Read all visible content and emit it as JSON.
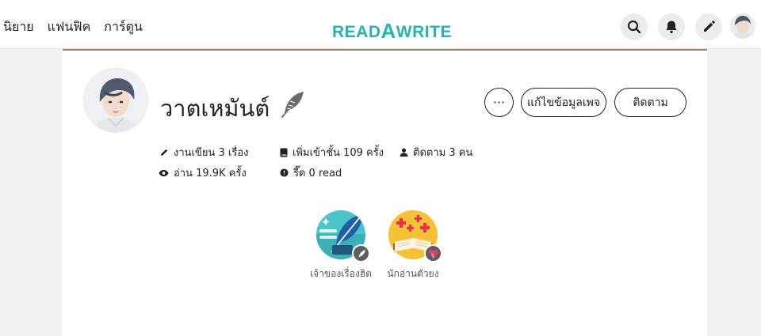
{
  "header": {
    "nav": [
      "นิยาย",
      "แฟนฟิค",
      "การ์ตูน"
    ],
    "logo_parts": [
      "READ",
      "A",
      "WRITE"
    ],
    "icons": [
      "search-icon",
      "bell-icon",
      "pencil-icon"
    ]
  },
  "profile": {
    "name": "วาตเหมันต์",
    "buttons": {
      "more": "···",
      "edit": "แก้ไขข้อมูลเพจ",
      "follow": "ติดตาม"
    },
    "stats": {
      "works": "งานเขียน 3 เรื่อง",
      "shelf": "เพิ่มเข้าชั้น 109 ครั้ง",
      "followers": "ติดตาม 3 คน",
      "reads": "อ่าน 19.9K ครั้ง",
      "coins": "รี๊ด 0 read"
    },
    "badges": [
      {
        "label": "เจ้าของเรื่องฮิต",
        "icon": "quill-badge-icon"
      },
      {
        "label": "นักอ่านตัวยง",
        "icon": "book-badge-icon"
      }
    ]
  },
  "colors": {
    "brand": "#25b4b1",
    "card_top_border": "#9a7f66",
    "background": "#f2f2f2"
  }
}
